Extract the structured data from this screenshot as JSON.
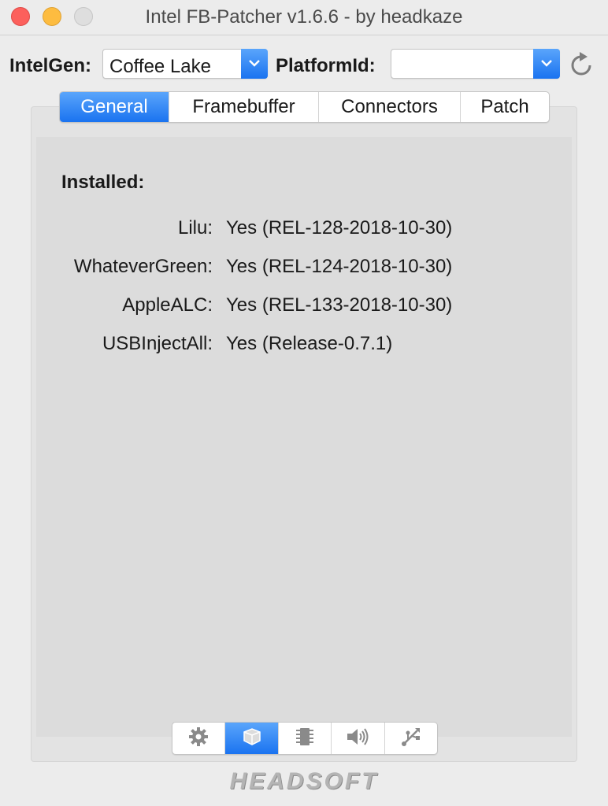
{
  "window": {
    "title": "Intel FB-Patcher v1.6.6 - by headkaze"
  },
  "toolbar": {
    "intelgen_label": "IntelGen:",
    "intelgen_value": "Coffee Lake",
    "platformid_label": "PlatformId:",
    "platformid_value": "",
    "refresh_icon": "refresh-icon"
  },
  "tabs": [
    {
      "label": "General",
      "active": true
    },
    {
      "label": "Framebuffer",
      "active": false
    },
    {
      "label": "Connectors",
      "active": false
    },
    {
      "label": "Patch",
      "active": false
    }
  ],
  "general": {
    "installed_heading": "Installed:",
    "rows": [
      {
        "label": "Lilu:",
        "value": "Yes (REL-128-2018-10-30)"
      },
      {
        "label": "WhateverGreen:",
        "value": "Yes (REL-124-2018-10-30)"
      },
      {
        "label": "AppleALC:",
        "value": "Yes (REL-133-2018-10-30)"
      },
      {
        "label": "USBInjectAll:",
        "value": "Yes (Release-0.7.1)"
      }
    ]
  },
  "bottom_icons": [
    {
      "icon": "gear-icon",
      "active": false
    },
    {
      "icon": "box-icon",
      "active": true
    },
    {
      "icon": "chip-icon",
      "active": false
    },
    {
      "icon": "speaker-icon",
      "active": false
    },
    {
      "icon": "usb-icon",
      "active": false
    }
  ],
  "footer": {
    "logo_text": "HEADSOFT"
  },
  "colors": {
    "accent": "#1a73f0",
    "window_bg": "#ececec",
    "panel_bg": "#dcdcdc",
    "close": "#fc605c",
    "minimize": "#fdbc40",
    "zoom_disabled": "#dedede"
  }
}
